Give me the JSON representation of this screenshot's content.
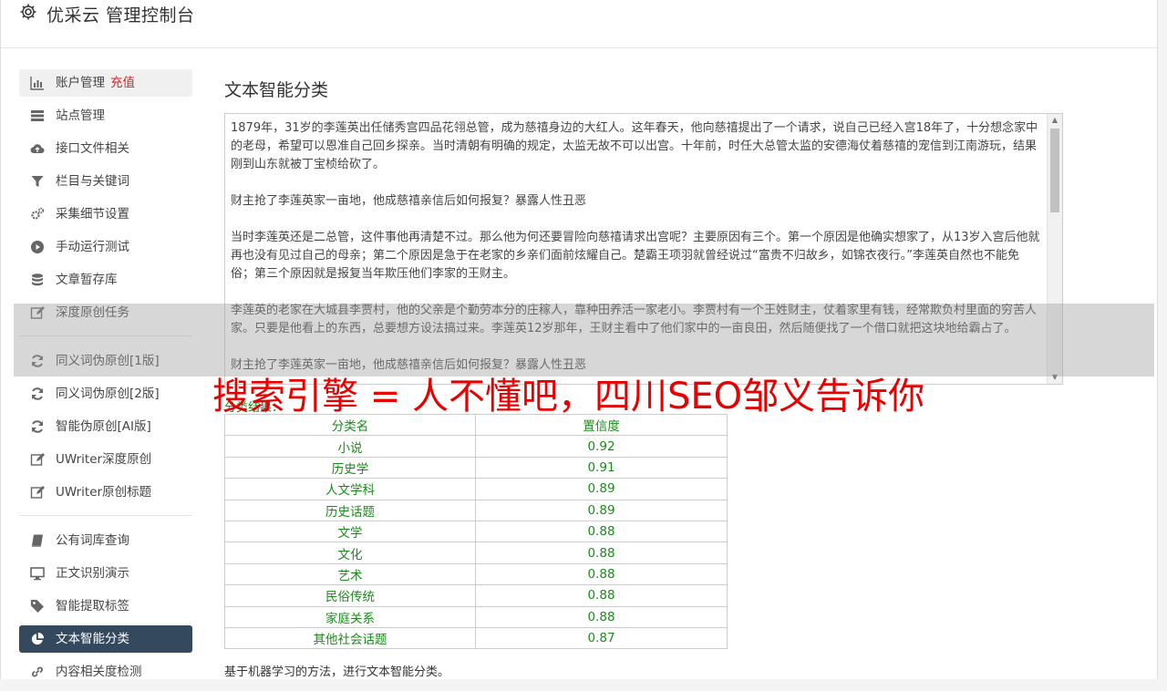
{
  "app": {
    "title": "优采云 管理控制台"
  },
  "sidebar": {
    "group1": [
      {
        "label": "账户管理",
        "extra": "充值",
        "icon": "bar-chart-icon"
      },
      {
        "label": "站点管理",
        "icon": "server-icon"
      },
      {
        "label": "接口文件相关",
        "icon": "cloud-upload-icon"
      },
      {
        "label": "栏目与关键词",
        "icon": "filter-icon"
      },
      {
        "label": "采集细节设置",
        "icon": "gears-icon"
      },
      {
        "label": "手动运行测试",
        "icon": "play-circle-icon"
      },
      {
        "label": "文章暂存库",
        "icon": "database-icon"
      },
      {
        "label": "深度原创任务",
        "icon": "edit-icon"
      }
    ],
    "group2": [
      {
        "label": "同义词伪原创[1版]",
        "icon": "refresh-icon"
      },
      {
        "label": "同义词伪原创[2版]",
        "icon": "refresh-icon"
      },
      {
        "label": "智能伪原创[AI版]",
        "icon": "refresh-icon"
      },
      {
        "label": "UWriter深度原创",
        "icon": "edit-icon"
      },
      {
        "label": "UWriter原创标题",
        "icon": "edit-icon"
      }
    ],
    "group3": [
      {
        "label": "公有词库查询",
        "icon": "book-icon"
      },
      {
        "label": "正文识别演示",
        "icon": "monitor-icon"
      },
      {
        "label": "智能提取标签",
        "icon": "tag-icon"
      },
      {
        "label": "文本智能分类",
        "icon": "pie-chart-icon"
      },
      {
        "label": "内容相关度检测",
        "icon": "link-icon"
      }
    ]
  },
  "main": {
    "title": "文本智能分类",
    "text_paragraphs": [
      "1879年，31岁的李莲英出任储秀宫四品花翎总管，成为慈禧身边的大红人。这年春天，他向慈禧提出了一个请求，说自己已经入宫18年了，十分想念家中的老母，希望可以恩准自己回乡探亲。当时清朝有明确的规定，太监无故不可以出宫。十年前，时任大总管太监的安德海仗着慈禧的宠信到江南游玩，结果刚到山东就被丁宝桢给砍了。",
      "财主抢了李莲英家一亩地，他成慈禧亲信后如何报复？暴露人性丑恶",
      "当时李莲英还是二总管，这件事他再清楚不过。那么他为何还要冒险向慈禧请求出宫呢？主要原因有三个。第一个原因是他确实想家了，从13岁入宫后他就再也没有见过自己的母亲；第二个原因是急于在老家的乡亲们面前炫耀自己。楚霸王项羽就曾经说过“富贵不归故乡，如锦衣夜行。”李莲英自然也不能免俗；第三个原因就是报复当年欺压他们李家的王财主。",
      "李莲英的老家在大城县李贾村，他的父亲是个勤劳本分的庄稼人，靠种田养活一家老小。李贾村有一个王姓财主，仗着家里有钱，经常欺负村里面的穷苦人家。只要是他看上的东西，总要想方设法搞过来。李莲英12岁那年，王财主看中了他们家中的一亩良田，然后随便找了一个借口就把这块地给霸占了。",
      "财主抢了李莲英家一亩地，他成慈禧亲信后如何报复？暴露人性丑恶"
    ],
    "result_label": "分类结果：",
    "table_headers": [
      "分类名",
      "置信度"
    ],
    "rows": [
      [
        "小说",
        "0.92"
      ],
      [
        "历史学",
        "0.91"
      ],
      [
        "人文学科",
        "0.89"
      ],
      [
        "历史话题",
        "0.89"
      ],
      [
        "文学",
        "0.88"
      ],
      [
        "文化",
        "0.88"
      ],
      [
        "艺术",
        "0.88"
      ],
      [
        "民俗传统",
        "0.88"
      ],
      [
        "家庭关系",
        "0.88"
      ],
      [
        "其他社会话题",
        "0.87"
      ]
    ],
    "caption": "基于机器学习的方法，进行文本智能分类。"
  },
  "overlay": {
    "text": "搜索引擎 = 人不懂吧，四川SEO邹义告诉你"
  }
}
